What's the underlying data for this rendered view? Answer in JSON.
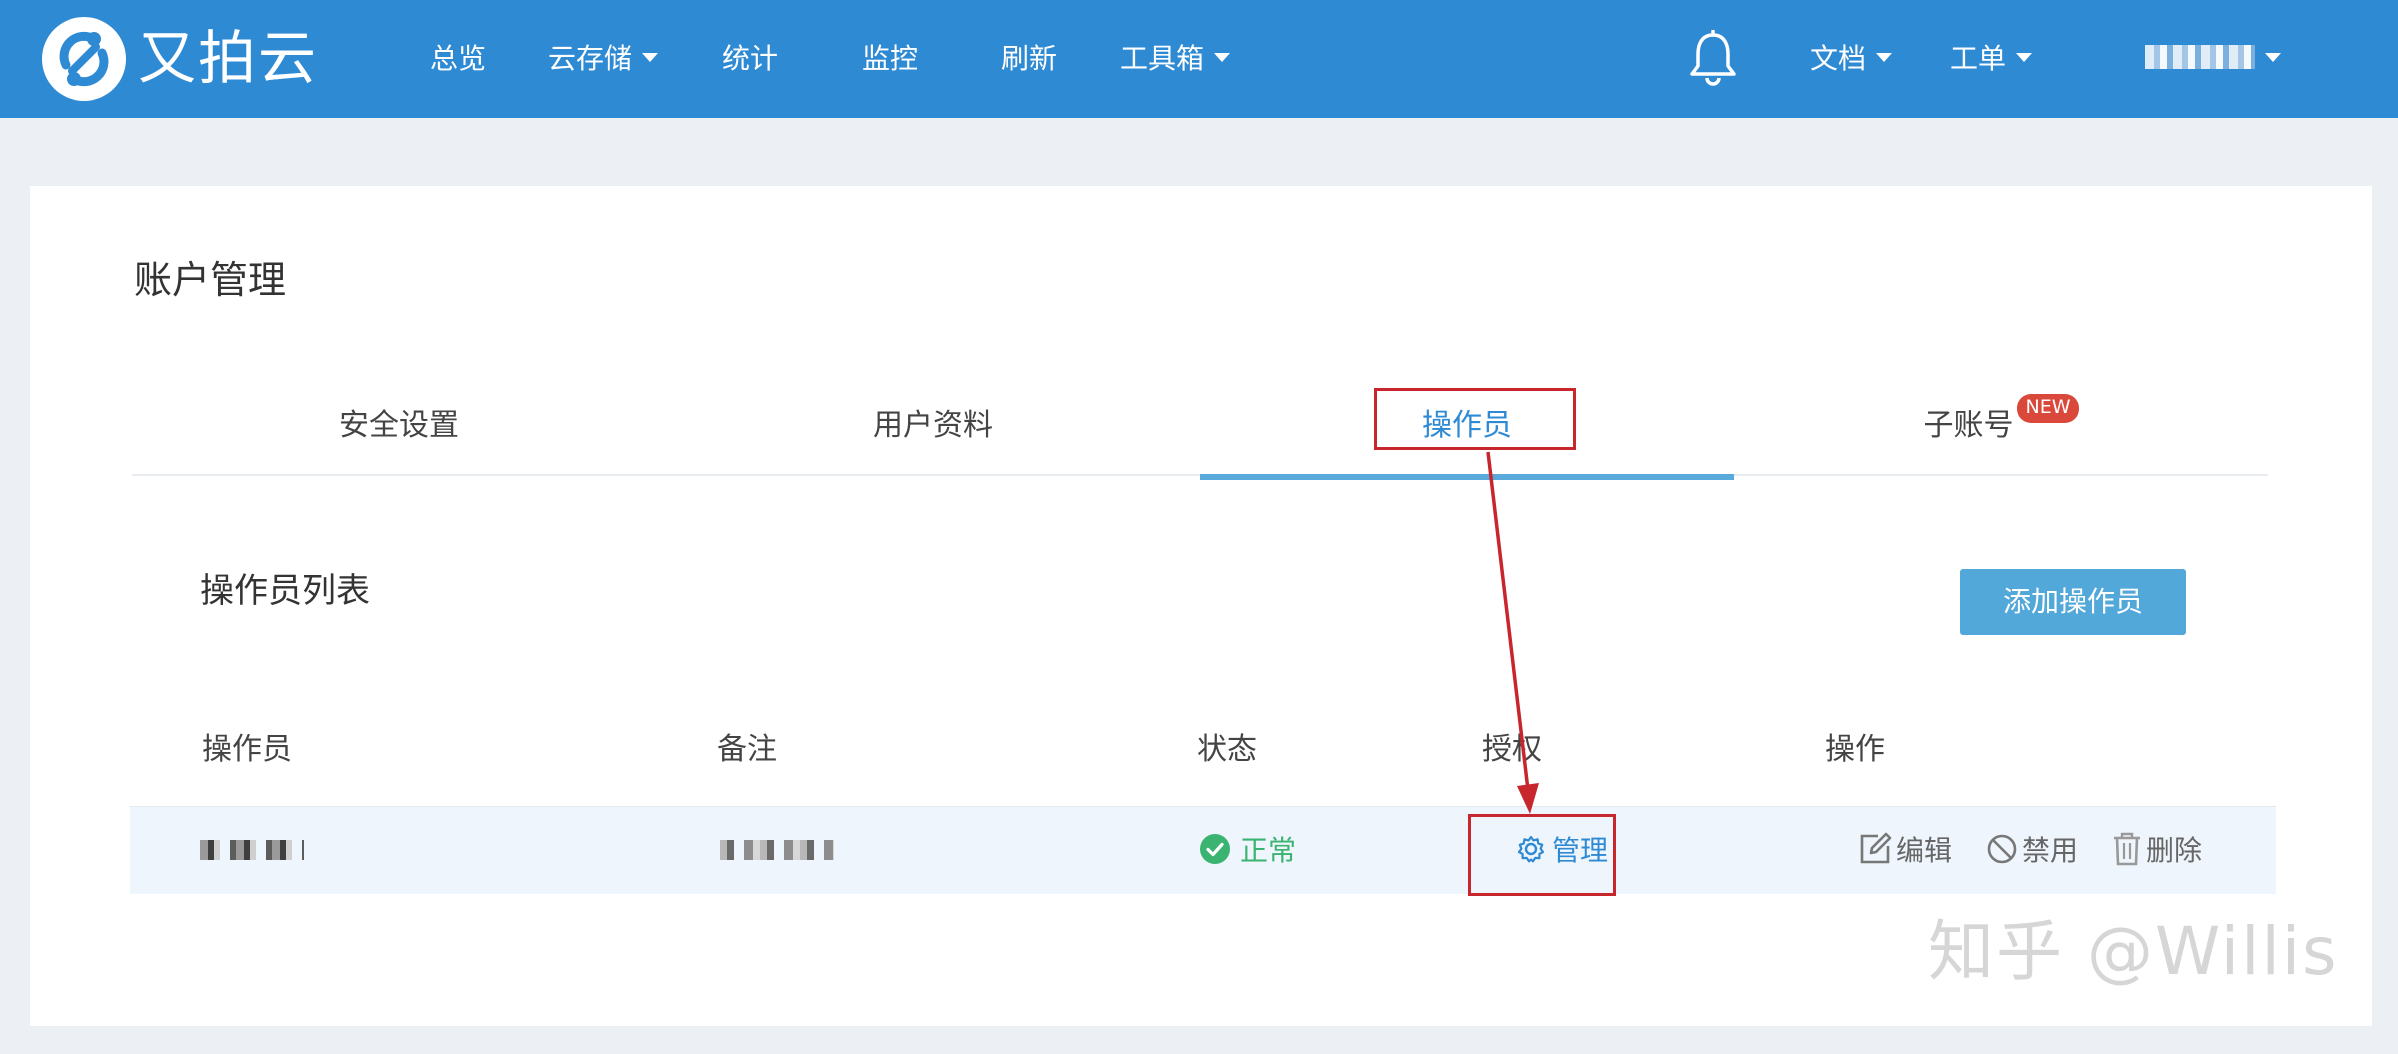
{
  "brand": {
    "name": "又拍云"
  },
  "nav": {
    "overview": "总览",
    "storage": "云存储",
    "stats": "统计",
    "monitor": "监控",
    "refresh": "刷新",
    "toolbox": "工具箱",
    "docs": "文档",
    "ticket": "工单"
  },
  "page": {
    "title": "账户管理"
  },
  "tabs": [
    {
      "label": "安全设置"
    },
    {
      "label": "用户资料"
    },
    {
      "label": "操作员"
    },
    {
      "label": "子账号",
      "badge": "NEW"
    }
  ],
  "section": {
    "title": "操作员列表",
    "add_button": "添加操作员"
  },
  "table": {
    "headers": [
      "操作员",
      "备注",
      "状态",
      "授权",
      "操作"
    ],
    "rows": [
      {
        "status": "正常",
        "auth": "管理",
        "actions": {
          "edit": "编辑",
          "disable": "禁用",
          "delete": "删除"
        }
      }
    ]
  },
  "watermark": "知乎 @Willis",
  "colors": {
    "topbar": "#2f8ad4",
    "accent": "#52a8d9",
    "status_ok": "#3bb371",
    "annotation": "#c8262d",
    "badge": "#d9483b"
  }
}
